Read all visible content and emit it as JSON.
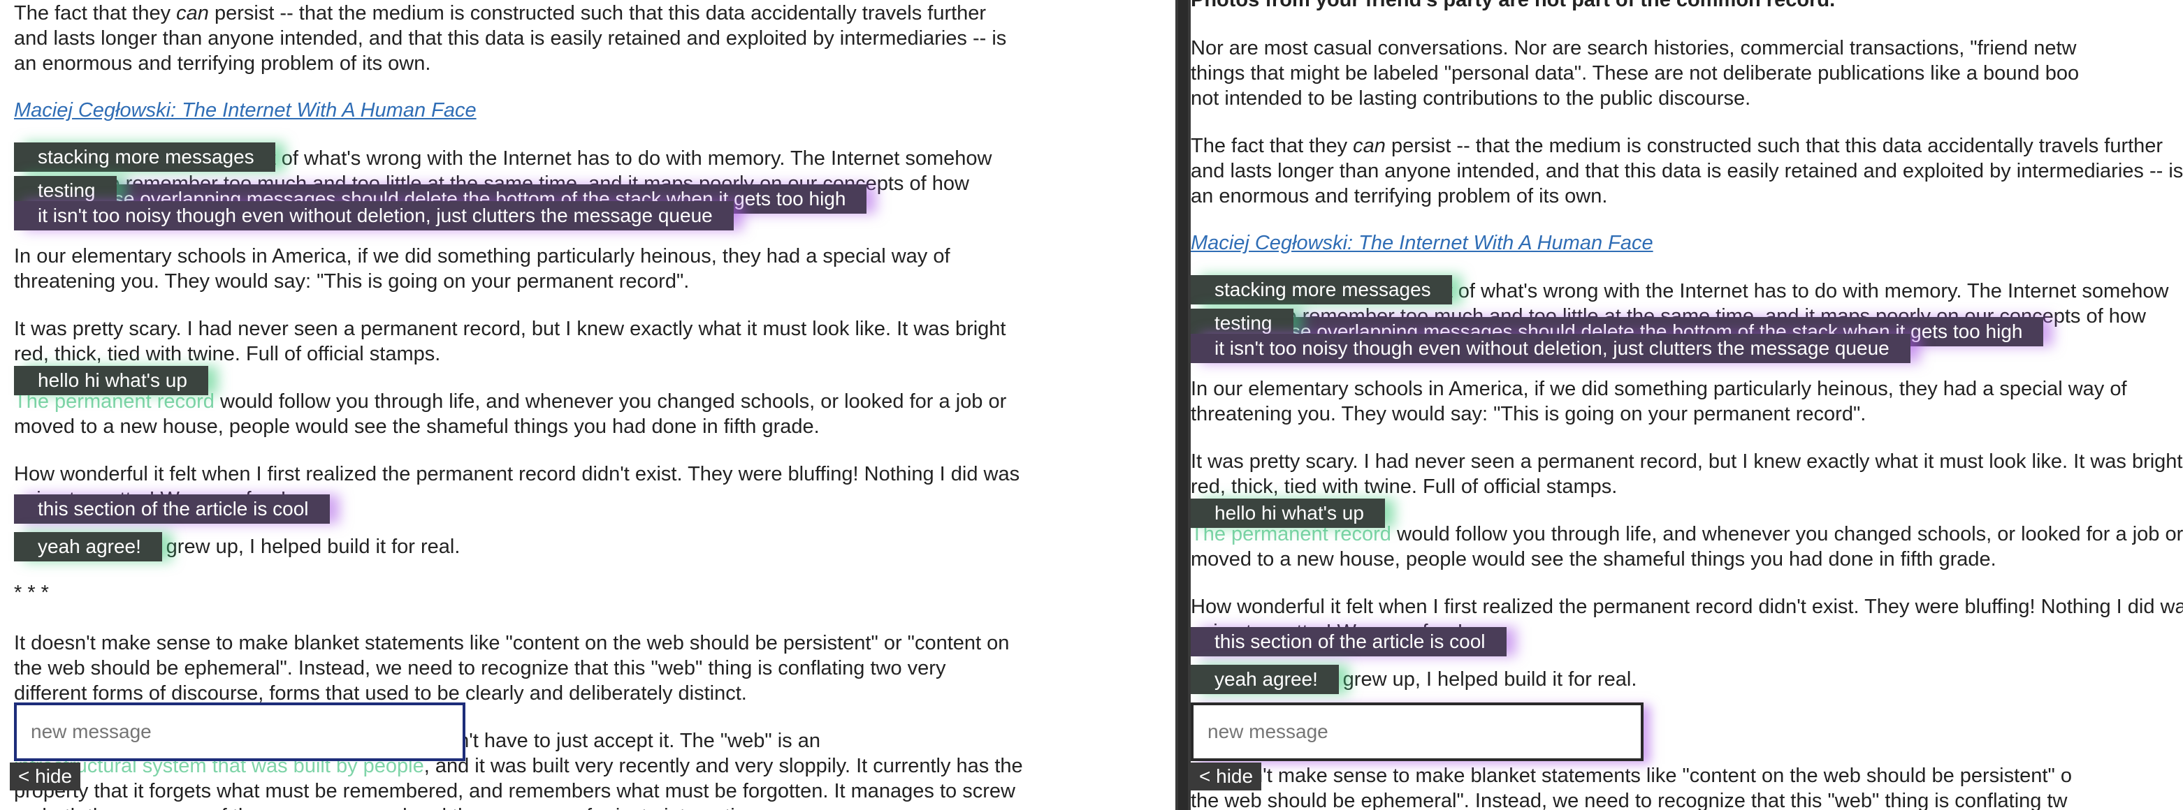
{
  "article": {
    "heading": "Photos from your friend's party are not part of the common record.",
    "para_not_casual_1": "Nor are most casual conversations. Nor are search histories, commercial transactions, \"friend netw",
    "para_not_casual_2": "things that might be labeled \"personal data\". These are not deliberate publications like a bound boo",
    "para_not_casual_3": "not intended to be lasting contributions to the public discourse.",
    "persist_1_pre": "The fact that they ",
    "persist_1_em": "can",
    "persist_1_post": " persist -- that the medium is constructed such that this data accidentally travels further",
    "persist_2": "and lasts longer than anyone intended, and that this data is easily retained and exploited by intermediaries -- is",
    "persist_3": "an enormous and terrifying problem of its own.",
    "link": "Maciej Cegłowski: The Internet With A Human Face",
    "memory_1": "I've come to believe that a lot of what's wrong with the Internet has to do with memory. The Internet somehow",
    "memory_2": "manages to remember too much and too little at the same time, and it maps poorly on our concepts of how",
    "elementary_1": "In our elementary schools in America, if we did something particularly heinous, they had a special way of",
    "elementary_2": "threatening you. They would say: \"This is going on your permanent record\".",
    "scary_1": "It was pretty scary. I had never seen a permanent record, but I knew exactly what it must look like. It was bright",
    "scary_2": "red, thick, tied with twine. Full of official stamps.",
    "follow_1_faint": "The permanent record",
    "follow_1": " would follow you through life, and whenever you changed schools, or looked for a job or",
    "follow_2": "moved to a new house, people would see the shameful things you had done in fifth grade.",
    "wonderful_1": "How wonderful it felt when I first realized the permanent record didn't exist. They were bluffing! Nothing I did was",
    "wonderful_2": "going to matter! We were free!",
    "grewup": "And then when I grew up, I helped build it for real.",
    "separator": "* * *",
    "sense_1": "It doesn't make sense to make blanket statements like \"content on the web should be persistent\" or \"content on",
    "sense_2": "the web should be ephemeral\". Instead, we need to recognize that this \"web\" thing is conflating two very",
    "sense_3": "different forms of discourse, forms that used to be clearly and deliberately distinct.",
    "discovered_1": "This is a problem that we have discovered; we don't have to just accept it. The \"web\" is an",
    "discovered_2_faint": "infrastructural system that was built by people",
    "discovered_2": ", and it was built very recently and very sloppily. It currently has the",
    "discovered_3": "property that it forgets what must be remembered, and remembers what must be forgotten. It manages to screw",
    "discovered_4": "up both the purposes of the common record and the purposes of private interaction.",
    "right_sense_1": "It doesn't make sense to make blanket statements like \"content on the web should be persistent\" o",
    "right_sense_2": "the web should be ephemeral\". Instead, we need to recognize that this \"web\" thing is conflating tw"
  },
  "messages": [
    {
      "id": "stacking",
      "text": "stacking more messages",
      "tone": "green"
    },
    {
      "id": "testing",
      "text": "testing",
      "tone": "green"
    },
    {
      "id": "overlap",
      "text": "these overlapping messages should delete the bottom of the stack when it gets too high",
      "tone": "purple"
    },
    {
      "id": "noisy",
      "text": "it isn't too noisy though even without deletion, just clutters the message queue",
      "tone": "purple"
    },
    {
      "id": "hello",
      "text": "hello hi what's up",
      "tone": "green"
    },
    {
      "id": "cool",
      "text": "this section of the article is cool",
      "tone": "purple"
    },
    {
      "id": "agree",
      "text": "yeah agree!",
      "tone": "green"
    }
  ],
  "composer": {
    "placeholder": "new message",
    "hide_label": "< hide"
  }
}
